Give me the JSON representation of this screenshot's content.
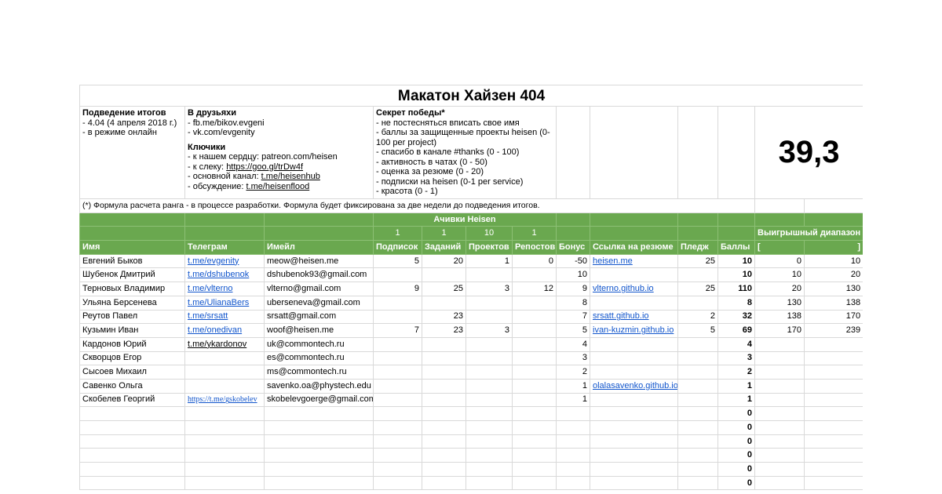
{
  "title": "Макатон Хайзен 404",
  "info": {
    "col1": {
      "heading": "Подведение итогов",
      "lines": [
        "- 4.04 (4 апреля 2018 г.)",
        "- в режиме онлайн"
      ]
    },
    "col2": {
      "heading": "В друзьяхи",
      "lines": [
        "- fb.me/bikov.evgeni",
        "- vk.com/evgenity"
      ],
      "heading2": "Ключики",
      "lines2": [
        {
          "prefix": "- к нашем сердцу: ",
          "link": "patreon.com/heisen",
          "underline": false
        },
        {
          "prefix": "- к слеку: ",
          "link": "https://goo.gl/trDw4f",
          "underline": true
        },
        {
          "prefix": "- основной канал: ",
          "link": "t.me/heisenhub",
          "underline": true
        },
        {
          "prefix": "- обсуждение: ",
          "link": "t.me/heisenflood",
          "underline": true
        }
      ]
    },
    "col3": {
      "heading": "Секрет победы*",
      "lines": [
        "- не постесняться вписать свое имя",
        "- баллы за защищенные проекты heisen (0-",
        "100 per project)",
        "- спасибо в канале #thanks (0 - 100)",
        "- активность в чатах (0 - 50)",
        "- оценка за резюме (0 - 20)",
        "- подписки на heisen (0-1 per service)",
        "- красота (0 - 1)"
      ]
    },
    "score": "39,3"
  },
  "note": "(*) Формула расчета ранга - в процессе разработки. Формула будет фиксирована за две недели до подведения итогов.",
  "header": {
    "achievements_label": "Ачивки Heisen",
    "weights": [
      "1",
      "1",
      "10",
      "1"
    ],
    "range_label": "Выигрышный диапазон",
    "columns": [
      "Имя",
      "Телеграм",
      "Имейл",
      "Подписок",
      "Заданий",
      "Проектов",
      "Репостов",
      "Бонус",
      "Ссылка на резюме",
      "Пледж",
      "Баллы",
      "[",
      "]"
    ]
  },
  "rows": [
    {
      "name": "Евгений Быков",
      "tg": "t.me/evgenity",
      "tg_style": "blue",
      "email": "meow@heisen.me",
      "subs": "5",
      "tasks": "20",
      "projects": "1",
      "reposts": "0",
      "bonus": "-50",
      "resume": "heisen.me",
      "pledge": "25",
      "score": "10",
      "from": "0",
      "to": "10"
    },
    {
      "name": "Шубенок Дмитрий",
      "tg": "t.me/dshubenok",
      "tg_style": "blue",
      "email": "dshubenok93@gmail.com",
      "subs": "",
      "tasks": "",
      "projects": "",
      "reposts": "",
      "bonus": "10",
      "resume": "",
      "pledge": "",
      "score": "10",
      "from": "10",
      "to": "20"
    },
    {
      "name": "Терновых Владимир",
      "tg": "t.me/vlterno",
      "tg_style": "blue",
      "email": "vlterno@gmail.com",
      "subs": "9",
      "tasks": "25",
      "projects": "3",
      "reposts": "12",
      "bonus": "9",
      "resume": "vlterno.github.io",
      "pledge": "25",
      "score": "110",
      "from": "20",
      "to": "130"
    },
    {
      "name": "Ульяна Берсенева",
      "tg": "t.me/UlianaBers",
      "tg_style": "blue",
      "email": "uberseneva@gmail.com",
      "subs": "",
      "tasks": "",
      "projects": "",
      "reposts": "",
      "bonus": "8",
      "resume": "",
      "pledge": "",
      "score": "8",
      "from": "130",
      "to": "138"
    },
    {
      "name": "Реутов Павел",
      "tg": "t.me/srsatt",
      "tg_style": "blue",
      "email": "srsatt@gmail.com",
      "subs": "",
      "tasks": "23",
      "projects": "",
      "reposts": "",
      "bonus": "7",
      "resume": "srsatt.github.io",
      "pledge": "2",
      "score": "32",
      "from": "138",
      "to": "170"
    },
    {
      "name": "Кузьмин Иван",
      "tg": "t.me/onedivan",
      "tg_style": "blue",
      "email": "woof@heisen.me",
      "subs": "7",
      "tasks": "23",
      "projects": "3",
      "reposts": "",
      "bonus": "5",
      "resume": "ivan-kuzmin.github.io",
      "pledge": "5",
      "score": "69",
      "from": "170",
      "to": "239"
    },
    {
      "name": "Кардонов Юрий",
      "tg": "t.me/ykardonov",
      "tg_style": "dark",
      "email": "uk@commontech.ru",
      "subs": "",
      "tasks": "",
      "projects": "",
      "reposts": "",
      "bonus": "4",
      "resume": "",
      "pledge": "",
      "score": "4",
      "from": "",
      "to": ""
    },
    {
      "name": "Скворцов Егор",
      "tg": "",
      "tg_style": "blue",
      "email": "es@commontech.ru",
      "subs": "",
      "tasks": "",
      "projects": "",
      "reposts": "",
      "bonus": "3",
      "resume": "",
      "pledge": "",
      "score": "3",
      "from": "",
      "to": ""
    },
    {
      "name": "Сысоев Михаил",
      "tg": "",
      "tg_style": "blue",
      "email": "ms@commontech.ru",
      "subs": "",
      "tasks": "",
      "projects": "",
      "reposts": "",
      "bonus": "2",
      "resume": "",
      "pledge": "",
      "score": "2",
      "from": "",
      "to": ""
    },
    {
      "name": "Савенко Ольга",
      "tg": "",
      "tg_style": "blue",
      "email": "savenko.oa@phystech.edu",
      "subs": "",
      "tasks": "",
      "projects": "",
      "reposts": "",
      "bonus": "1",
      "resume": "olalasavenko.github.io",
      "pledge": "",
      "score": "1",
      "from": "",
      "to": ""
    },
    {
      "name": "Скобелев Георгий",
      "tg": "https://t.me/gskobelev",
      "tg_style": "serif",
      "email": "skobelevgoerge@gmail.com",
      "subs": "",
      "tasks": "",
      "projects": "",
      "reposts": "",
      "bonus": "1",
      "resume": "",
      "pledge": "",
      "score": "1",
      "from": "",
      "to": ""
    },
    {
      "name": "",
      "tg": "",
      "tg_style": "blue",
      "email": "",
      "subs": "",
      "tasks": "",
      "projects": "",
      "reposts": "",
      "bonus": "",
      "resume": "",
      "pledge": "",
      "score": "0",
      "from": "",
      "to": ""
    },
    {
      "name": "",
      "tg": "",
      "tg_style": "blue",
      "email": "",
      "subs": "",
      "tasks": "",
      "projects": "",
      "reposts": "",
      "bonus": "",
      "resume": "",
      "pledge": "",
      "score": "0",
      "from": "",
      "to": ""
    },
    {
      "name": "",
      "tg": "",
      "tg_style": "blue",
      "email": "",
      "subs": "",
      "tasks": "",
      "projects": "",
      "reposts": "",
      "bonus": "",
      "resume": "",
      "pledge": "",
      "score": "0",
      "from": "",
      "to": ""
    },
    {
      "name": "",
      "tg": "",
      "tg_style": "blue",
      "email": "",
      "subs": "",
      "tasks": "",
      "projects": "",
      "reposts": "",
      "bonus": "",
      "resume": "",
      "pledge": "",
      "score": "0",
      "from": "",
      "to": ""
    },
    {
      "name": "",
      "tg": "",
      "tg_style": "blue",
      "email": "",
      "subs": "",
      "tasks": "",
      "projects": "",
      "reposts": "",
      "bonus": "",
      "resume": "",
      "pledge": "",
      "score": "0",
      "from": "",
      "to": ""
    },
    {
      "name": "",
      "tg": "",
      "tg_style": "blue",
      "email": "",
      "subs": "",
      "tasks": "",
      "projects": "",
      "reposts": "",
      "bonus": "",
      "resume": "",
      "pledge": "",
      "score": "0",
      "from": "",
      "to": ""
    }
  ]
}
